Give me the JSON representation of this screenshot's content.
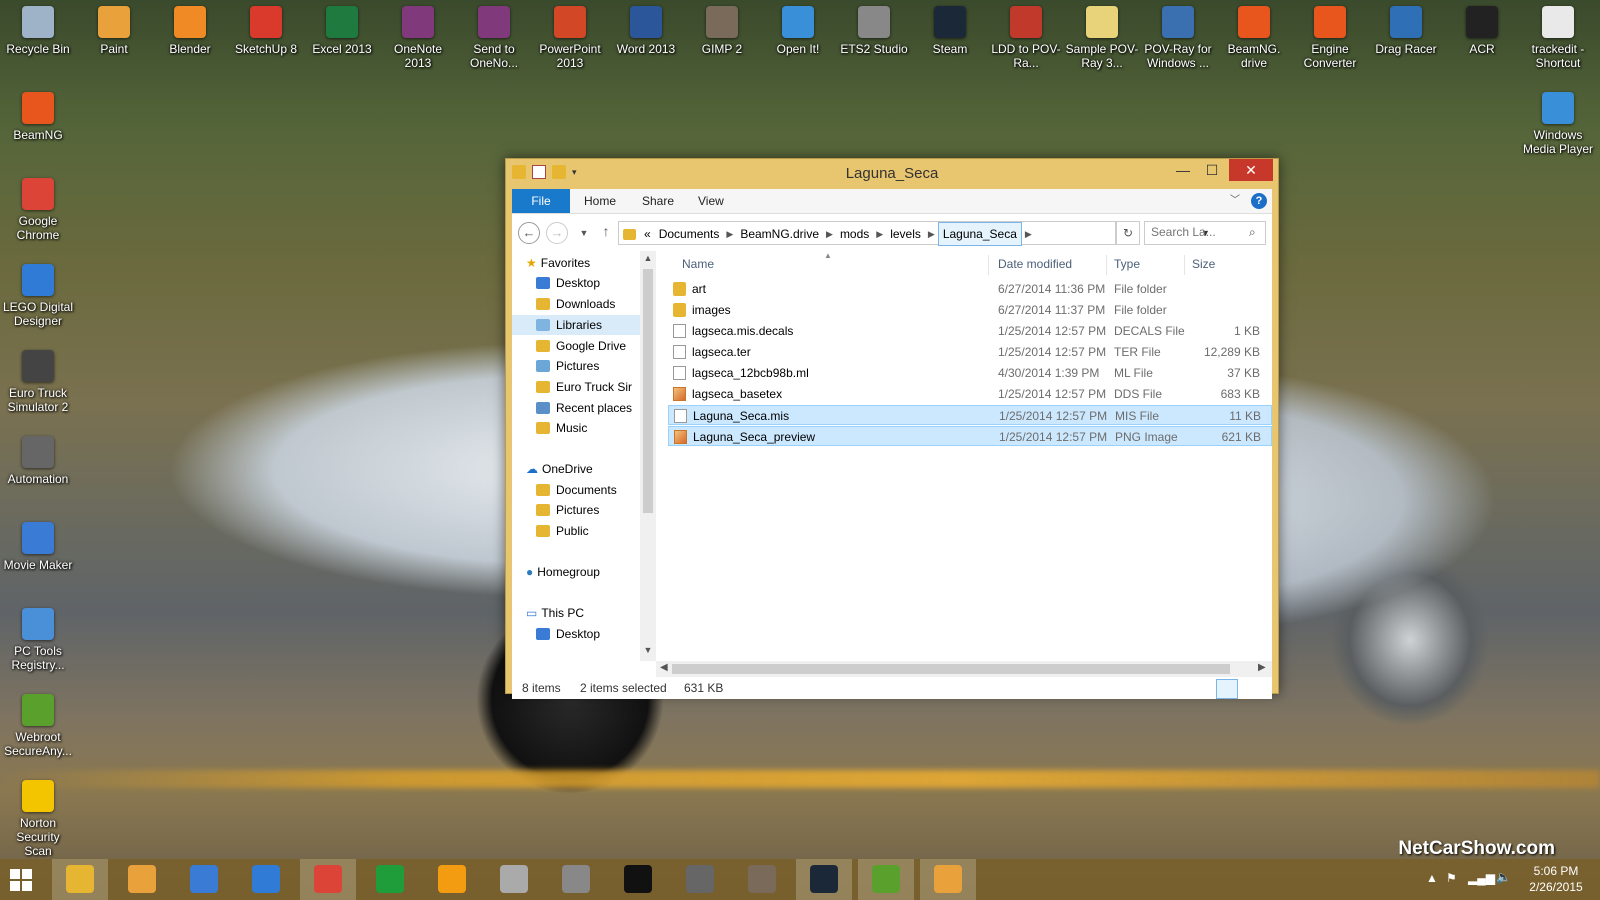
{
  "desktop": {
    "top_icons": [
      {
        "label": "Recycle Bin",
        "icon": "recycle-bin-icon",
        "color": "#9fb3c8"
      },
      {
        "label": "Paint",
        "icon": "paint-icon",
        "color": "#e9a23b"
      },
      {
        "label": "Blender",
        "icon": "blender-icon",
        "color": "#f08a24"
      },
      {
        "label": "SketchUp 8",
        "icon": "sketchup-icon",
        "color": "#d93a2b"
      },
      {
        "label": "Excel 2013",
        "icon": "excel-icon",
        "color": "#1f7a3f"
      },
      {
        "label": "OneNote 2013",
        "icon": "onenote-icon",
        "color": "#80397b"
      },
      {
        "label": "Send to OneNo...",
        "icon": "onenote-send-icon",
        "color": "#80397b"
      },
      {
        "label": "PowerPoint 2013",
        "icon": "powerpoint-icon",
        "color": "#d24726"
      },
      {
        "label": "Word 2013",
        "icon": "word-icon",
        "color": "#2b579a"
      },
      {
        "label": "GIMP 2",
        "icon": "gimp-icon",
        "color": "#7a6a5a"
      },
      {
        "label": "Open It!",
        "icon": "open-it-icon",
        "color": "#3a8fd9"
      },
      {
        "label": "ETS2 Studio",
        "icon": "ets2-studio-icon",
        "color": "#888888"
      },
      {
        "label": "Steam",
        "icon": "steam-icon",
        "color": "#1b2838"
      },
      {
        "label": "LDD to POV-Ra...",
        "icon": "ldd-pov-icon",
        "color": "#c0392b"
      },
      {
        "label": "Sample POV-Ray 3...",
        "icon": "pov-sample-icon",
        "color": "#e8d27a"
      },
      {
        "label": "POV-Ray for Windows ...",
        "icon": "povray-icon",
        "color": "#3a6fb0"
      },
      {
        "label": "BeamNG. drive",
        "icon": "beamng-icon",
        "color": "#e8561e"
      },
      {
        "label": "Engine Converter",
        "icon": "engine-converter-icon",
        "color": "#e8561e"
      },
      {
        "label": "Drag Racer",
        "icon": "drag-racer-icon",
        "color": "#2f6fb5"
      },
      {
        "label": "ACR",
        "icon": "acr-icon",
        "color": "#222222"
      },
      {
        "label": "trackedit - Shortcut",
        "icon": "trackedit-icon",
        "color": "#e9e9e9"
      }
    ],
    "left_icons": [
      {
        "label": "BeamNG",
        "icon": "beamng-icon",
        "color": "#e8561e"
      },
      {
        "label": "Google Chrome",
        "icon": "chrome-icon",
        "color": "#db4437"
      },
      {
        "label": "LEGO Digital Designer",
        "icon": "lego-icon",
        "color": "#2f7bd6"
      },
      {
        "label": "Euro Truck Simulator 2",
        "icon": "ets2-icon",
        "color": "#444444"
      },
      {
        "label": "Automation",
        "icon": "automation-icon",
        "color": "#666666"
      },
      {
        "label": "Movie Maker",
        "icon": "movie-maker-icon",
        "color": "#3a7bd5"
      },
      {
        "label": "PC Tools Registry...",
        "icon": "pc-tools-icon",
        "color": "#4a90d9"
      },
      {
        "label": "Webroot SecureAny...",
        "icon": "webroot-icon",
        "color": "#5aa02c"
      },
      {
        "label": "Norton Security Scan",
        "icon": "norton-icon",
        "color": "#f2c500"
      }
    ],
    "right_icons": [
      {
        "label": "Windows Media Player",
        "icon": "media-player-icon",
        "color": "#3a8fd9"
      }
    ],
    "watermark": "NetCarShow.com"
  },
  "window": {
    "title": "Laguna_Seca",
    "ribbon_tabs": [
      "File",
      "Home",
      "Share",
      "View"
    ],
    "breadcrumb_prefix": "«",
    "breadcrumb": [
      "Documents",
      "BeamNG.drive",
      "mods",
      "levels",
      "Laguna_Seca"
    ],
    "search_placeholder": "Search La...",
    "nav": {
      "favorites": "Favorites",
      "favorites_items": [
        "Desktop",
        "Downloads",
        "Libraries",
        "Google Drive",
        "Pictures",
        "Euro Truck Sir",
        "Recent places",
        "Music"
      ],
      "onedrive": "OneDrive",
      "onedrive_items": [
        "Documents",
        "Pictures",
        "Public"
      ],
      "homegroup": "Homegroup",
      "thispc": "This PC",
      "thispc_items": [
        "Desktop"
      ]
    },
    "columns": {
      "name": "Name",
      "date": "Date modified",
      "type": "Type",
      "size": "Size"
    },
    "files": [
      {
        "name": "art",
        "date": "6/27/2014 11:36 PM",
        "type": "File folder",
        "size": "",
        "kind": "folder",
        "selected": false
      },
      {
        "name": "images",
        "date": "6/27/2014 11:37 PM",
        "type": "File folder",
        "size": "",
        "kind": "folder",
        "selected": false
      },
      {
        "name": "lagseca.mis.decals",
        "date": "1/25/2014 12:57 PM",
        "type": "DECALS File",
        "size": "1 KB",
        "kind": "doc",
        "selected": false
      },
      {
        "name": "lagseca.ter",
        "date": "1/25/2014 12:57 PM",
        "type": "TER File",
        "size": "12,289 KB",
        "kind": "doc",
        "selected": false
      },
      {
        "name": "lagseca_12bcb98b.ml",
        "date": "4/30/2014 1:39 PM",
        "type": "ML File",
        "size": "37 KB",
        "kind": "doc",
        "selected": false
      },
      {
        "name": "lagseca_basetex",
        "date": "1/25/2014 12:57 PM",
        "type": "DDS File",
        "size": "683 KB",
        "kind": "img",
        "selected": false
      },
      {
        "name": "Laguna_Seca.mis",
        "date": "1/25/2014 12:57 PM",
        "type": "MIS File",
        "size": "11 KB",
        "kind": "doc",
        "selected": true
      },
      {
        "name": "Laguna_Seca_preview",
        "date": "1/25/2014 12:57 PM",
        "type": "PNG Image",
        "size": "621 KB",
        "kind": "img",
        "selected": true
      }
    ],
    "status": {
      "items": "8 items",
      "selected": "2 items selected",
      "size": "631 KB"
    }
  },
  "taskbar": {
    "apps": [
      {
        "name": "file-explorer",
        "icon": "file-explorer-icon",
        "color": "#e6b632",
        "active": true
      },
      {
        "name": "paint",
        "icon": "paint-icon",
        "color": "#e9a23b",
        "active": false
      },
      {
        "name": "movie-maker",
        "icon": "movie-maker-icon",
        "color": "#3a7bd5",
        "active": false
      },
      {
        "name": "lego-designer",
        "icon": "lego-icon",
        "color": "#2f7bd6",
        "active": false
      },
      {
        "name": "chrome",
        "icon": "chrome-icon",
        "color": "#db4437",
        "active": true
      },
      {
        "name": "store",
        "icon": "store-icon",
        "color": "#1f9d3a",
        "active": false
      },
      {
        "name": "media-player",
        "icon": "media-player-icon",
        "color": "#f39c12",
        "active": false
      },
      {
        "name": "ets2-studio",
        "icon": "ets2-studio-icon",
        "color": "#aaaaaa",
        "active": false
      },
      {
        "name": "ets2",
        "icon": "ets2-icon",
        "color": "#888888",
        "active": false
      },
      {
        "name": "acr",
        "icon": "acr-icon",
        "color": "#111111",
        "active": false
      },
      {
        "name": "automation",
        "icon": "automation-icon",
        "color": "#666666",
        "active": false
      },
      {
        "name": "gimp",
        "icon": "gimp-icon",
        "color": "#7a6a5a",
        "active": false
      },
      {
        "name": "steam",
        "icon": "steam-icon",
        "color": "#1b2838",
        "active": true
      },
      {
        "name": "webroot",
        "icon": "webroot-icon",
        "color": "#5aa02c",
        "active": true
      },
      {
        "name": "paint-2",
        "icon": "paint-icon",
        "color": "#e9a23b",
        "active": true
      }
    ],
    "time": "5:06 PM",
    "date": "2/26/2015"
  }
}
